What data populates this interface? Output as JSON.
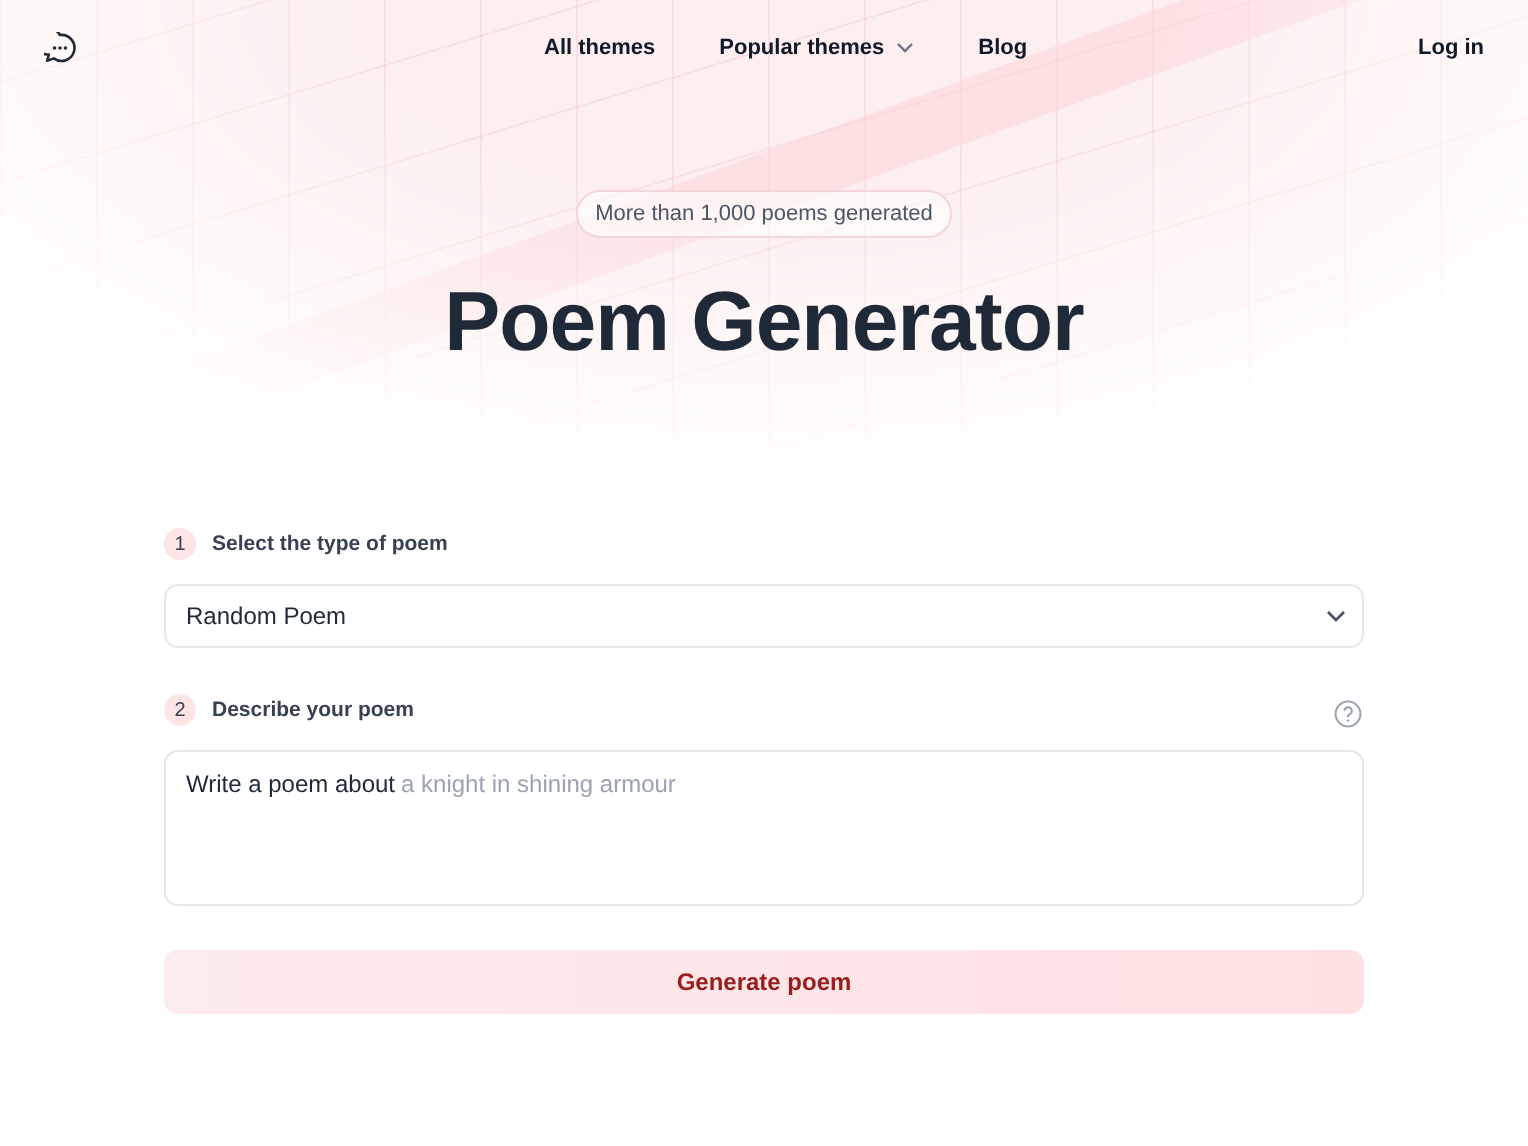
{
  "nav": {
    "links": [
      {
        "label": "All themes",
        "has_menu": false
      },
      {
        "label": "Popular themes",
        "has_menu": true
      },
      {
        "label": "Blog",
        "has_menu": false
      }
    ],
    "login": "Log in"
  },
  "hero": {
    "badge": "More than 1,000 poems generated",
    "title": "Poem Generator"
  },
  "form": {
    "steps": [
      {
        "number": "1",
        "label": "Select the type of poem",
        "kind": "select",
        "value": "Random Poem",
        "help": false
      },
      {
        "number": "2",
        "label": "Describe your poem",
        "kind": "textarea",
        "prefix": "Write a poem about",
        "placeholder": "a knight in shining armour",
        "help": true
      }
    ],
    "submit": "Generate poem"
  }
}
